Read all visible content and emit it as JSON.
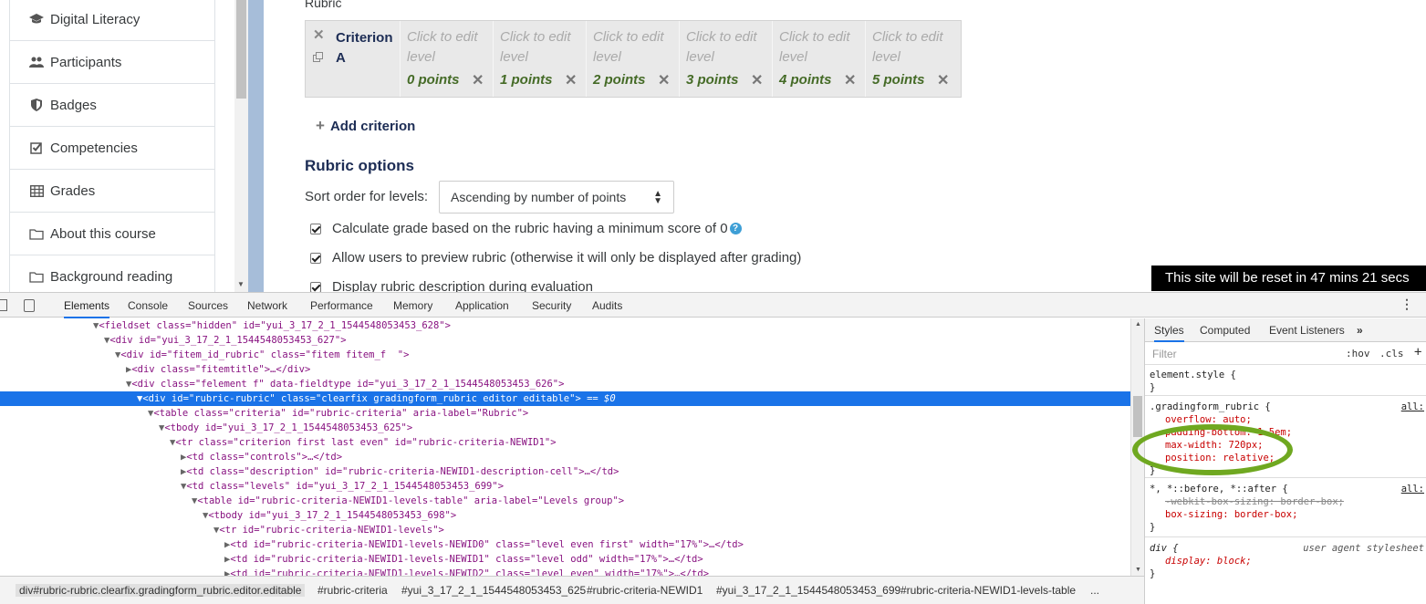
{
  "sidebar": {
    "items": [
      {
        "label": "Digital Literacy",
        "icon": "graduation-cap-icon"
      },
      {
        "label": "Participants",
        "icon": "users-icon"
      },
      {
        "label": "Badges",
        "icon": "shield-icon"
      },
      {
        "label": "Competencies",
        "icon": "checkbox-icon"
      },
      {
        "label": "Grades",
        "icon": "table-icon"
      },
      {
        "label": "About this course",
        "icon": "folder-icon"
      },
      {
        "label": "Background reading",
        "icon": "folder-icon"
      }
    ]
  },
  "rubric": {
    "label": "Rubric",
    "criterion": "Criterion A",
    "levels": [
      {
        "definition": "Click to edit level",
        "points": "0 points"
      },
      {
        "definition": "Click to edit level",
        "points": "1 points"
      },
      {
        "definition": "Click to edit level",
        "points": "2 points"
      },
      {
        "definition": "Click to edit level",
        "points": "3 points"
      },
      {
        "definition": "Click to edit level",
        "points": "4 points"
      },
      {
        "definition": "Click to edit level",
        "points": "5 points"
      }
    ],
    "add_criterion": "Add criterion"
  },
  "options": {
    "title": "Rubric options",
    "sort_label": "Sort order for levels:",
    "sort_value": "Ascending by number of points",
    "checks": [
      "Calculate grade based on the rubric having a minimum score of 0",
      "Allow users to preview rubric (otherwise it will only be displayed after grading)",
      "Display rubric description during evaluation"
    ]
  },
  "banner": "This site will be reset in 47 mins 21 secs",
  "devtools": {
    "tabs": [
      "Elements",
      "Console",
      "Sources",
      "Network",
      "Performance",
      "Memory",
      "Application",
      "Security",
      "Audits"
    ],
    "dom": [
      {
        "text": "<fieldset class=\"hidden\" id=\"yui_3_17_2_1_1544548053453_628\">"
      },
      {
        "text": "<div id=\"yui_3_17_2_1_1544548053453_627\">"
      },
      {
        "text": "<div id=\"fitem_id_rubric\" class=\"fitem fitem_f  \">"
      },
      {
        "text": "<div class=\"fitemtitle\">…</div>"
      },
      {
        "text": "<div class=\"felement f\" data-fieldtype id=\"yui_3_17_2_1_1544548053453_626\">"
      },
      {
        "text": "<div id=\"rubric-rubric\" class=\"clearfix gradingform_rubric editor editable\">"
      },
      {
        "text": "<table class=\"criteria\" id=\"rubric-criteria\" aria-label=\"Rubric\">"
      },
      {
        "text": "<tbody id=\"yui_3_17_2_1_1544548053453_625\">"
      },
      {
        "text": "<tr class=\"criterion first last even\" id=\"rubric-criteria-NEWID1\">"
      },
      {
        "text": "<td class=\"controls\">…</td>"
      },
      {
        "text": "<td class=\"description\" id=\"rubric-criteria-NEWID1-description-cell\">…</td>"
      },
      {
        "text": "<td class=\"levels\" id=\"yui_3_17_2_1_1544548053453_699\">"
      },
      {
        "text": "<table id=\"rubric-criteria-NEWID1-levels-table\" aria-label=\"Levels group\">"
      },
      {
        "text": "<tbody id=\"yui_3_17_2_1_1544548053453_698\">"
      },
      {
        "text": "<tr id=\"rubric-criteria-NEWID1-levels\">"
      },
      {
        "text": "<td id=\"rubric-criteria-NEWID1-levels-NEWID0\" class=\"level even first\" width=\"17%\">…</td>"
      },
      {
        "text": "<td id=\"rubric-criteria-NEWID1-levels-NEWID1\" class=\"level odd\" width=\"17%\">…</td>"
      },
      {
        "text": "<td id=\"rubric-criteria-NEWID1-levels-NEWID2\" class=\"level even\" width=\"17%\">…</td>"
      }
    ],
    "selected_suffix": "== $0",
    "breadcrumbs": [
      "div#rubric-rubric.clearfix.gradingform_rubric.editor.editable",
      "#rubric-criteria",
      "#yui_3_17_2_1_1544548053453_625",
      "#rubric-criteria-NEWID1",
      "#yui_3_17_2_1_1544548053453_699",
      "#rubric-criteria-NEWID1-levels-table",
      "..."
    ],
    "styles_tabs": [
      "Styles",
      "Computed",
      "Event Listeners",
      "»"
    ],
    "filter_placeholder": "Filter",
    "hov": ":hov",
    "cls": ".cls",
    "plus": "+",
    "rules": {
      "element_style": [
        "element.style {",
        "}"
      ],
      "gradingform": {
        "selector": ".gradingform_rubric {",
        "source": "all:",
        "props": [
          "overflow: auto;",
          "padding-bottom: 1.5em;",
          "max-width: 720px;",
          "position: relative;"
        ],
        "close": "}"
      },
      "universal": {
        "selector": "*, *::before, *::after {",
        "source": "all:",
        "props": [
          "-webkit-box-sizing: border-box;",
          "box-sizing: border-box;"
        ],
        "close": "}"
      },
      "div": {
        "selector": "div {",
        "source": "user agent stylesheet",
        "props": [
          "display: block;"
        ],
        "close": "}"
      }
    }
  },
  "colors": {
    "highlight": "#6fa820",
    "selection": "#1a73e8",
    "brand_navy": "#1d2d55",
    "points_green": "#456b27"
  }
}
